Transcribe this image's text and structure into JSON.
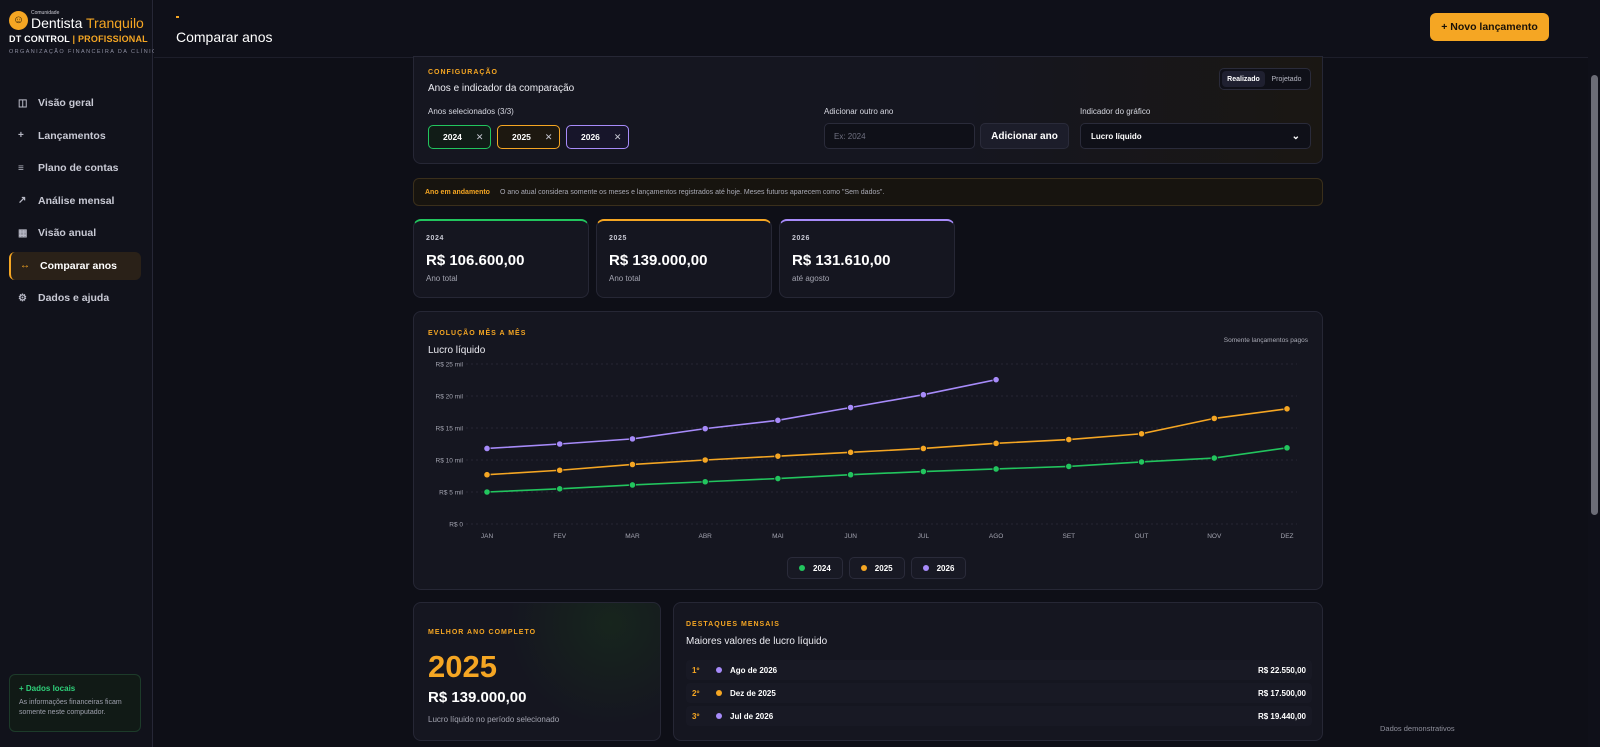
{
  "brand": {
    "small": "Comunidade",
    "name_a": "Dentista",
    "name_b": "Tranquilo",
    "sub_a": "DT CONTROL",
    "sub_sep": "|",
    "sub_b": "PROFISSIONAL",
    "org": "ORGANIZAÇÃO FINANCEIRA DA CLÍNICA"
  },
  "nav": [
    {
      "label": "Visão geral",
      "icon": "columns-icon",
      "glyph": "◫"
    },
    {
      "label": "Lançamentos",
      "icon": "plus-icon",
      "glyph": "+"
    },
    {
      "label": "Plano de contas",
      "icon": "list-icon",
      "glyph": "≡"
    },
    {
      "label": "Análise mensal",
      "icon": "trend-icon",
      "glyph": "↗"
    },
    {
      "label": "Visão anual",
      "icon": "calendar-icon",
      "glyph": "▦"
    },
    {
      "label": "Comparar anos",
      "icon": "compare-icon",
      "glyph": "↔"
    },
    {
      "label": "Dados e ajuda",
      "icon": "gear-icon",
      "glyph": "⚙"
    }
  ],
  "local": {
    "title": "+ Dados locais",
    "text": "As informações financeiras ficam somente neste computador."
  },
  "header": {
    "title": "Comparar anos",
    "new_button": "+ Novo lançamento"
  },
  "config": {
    "eyebrow": "CONFIGURAÇÃO",
    "title": "Anos e indicador da comparação",
    "toggle": [
      "Realizado",
      "Projetado"
    ],
    "selected_label": "Anos selecionados (3/3)",
    "chips": [
      "2024",
      "2025",
      "2026"
    ],
    "add_label": "Adicionar outro ano",
    "add_placeholder": "Ex: 2024",
    "add_button": "Adicionar ano",
    "indicator_label": "Indicador do gráfico",
    "indicator_value": "Lucro líquido"
  },
  "notice": {
    "title": "Ano em andamento",
    "text": "O ano atual considera somente os meses e lançamentos registrados até hoje. Meses futuros aparecem como \"Sem dados\"."
  },
  "stats": [
    {
      "year": "2024",
      "value": "R$ 106.600,00",
      "sub": "Ano total"
    },
    {
      "year": "2025",
      "value": "R$ 139.000,00",
      "sub": "Ano total"
    },
    {
      "year": "2026",
      "value": "R$ 131.610,00",
      "sub": "até agosto"
    }
  ],
  "chart": {
    "eyebrow": "EVOLUÇÃO MÊS A MÊS",
    "title": "Lucro líquido",
    "note": "Somente lançamentos pagos"
  },
  "chart_data": {
    "type": "line",
    "categories": [
      "JAN",
      "FEV",
      "MAR",
      "ABR",
      "MAI",
      "JUN",
      "JUL",
      "AGO",
      "SET",
      "OUT",
      "NOV",
      "DEZ"
    ],
    "y_ticks": [
      "R$ 0",
      "R$ 5 mil",
      "R$ 10 mil",
      "R$ 15 mil",
      "R$ 20 mil",
      "R$ 25 mil"
    ],
    "ylim": [
      0,
      25000
    ],
    "grid": true,
    "legend": "bottom-center",
    "series": [
      {
        "name": "2024",
        "color": "#22c55e",
        "values": [
          5000,
          5500,
          6100,
          6600,
          7100,
          7700,
          8200,
          8600,
          9000,
          9700,
          10300,
          11900
        ]
      },
      {
        "name": "2025",
        "color": "#f5a623",
        "values": [
          7700,
          8400,
          9300,
          10000,
          10600,
          11200,
          11800,
          12600,
          13200,
          14100,
          16500,
          18000
        ]
      },
      {
        "name": "2026",
        "color": "#a78bfa",
        "values": [
          11800,
          12500,
          13300,
          14900,
          16200,
          18200,
          20200,
          22550
        ]
      }
    ]
  },
  "best": {
    "eyebrow": "MELHOR ANO COMPLETO",
    "year": "2025",
    "value": "R$ 139.000,00",
    "sub": "Lucro líquido no período selecionado"
  },
  "highlights": {
    "eyebrow": "DESTAQUES MENSAIS",
    "title": "Maiores valores de lucro líquido",
    "rows": [
      {
        "rank": "1º",
        "label": "Ago de 2026",
        "value": "R$ 22.550,00",
        "color": "#a78bfa"
      },
      {
        "rank": "2º",
        "label": "Dez de 2025",
        "value": "R$ 17.500,00",
        "color": "#f5a623"
      },
      {
        "rank": "3º",
        "label": "Jul de 2026",
        "value": "R$ 19.440,00",
        "color": "#a78bfa"
      }
    ]
  },
  "footer": {
    "demo": "Dados demonstrativos"
  }
}
